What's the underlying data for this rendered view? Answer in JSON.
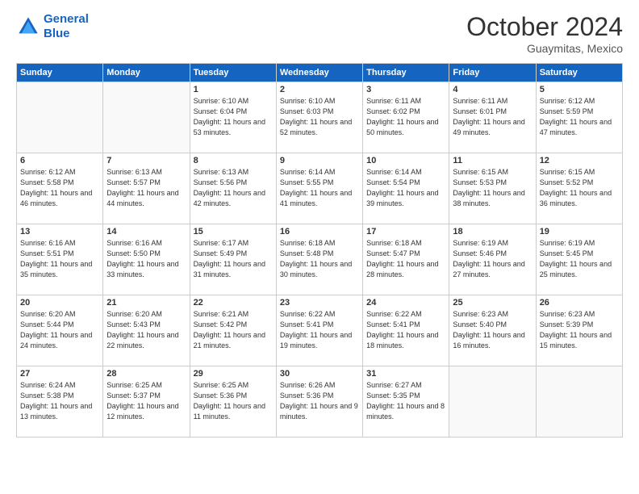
{
  "header": {
    "logo_line1": "General",
    "logo_line2": "Blue",
    "month": "October 2024",
    "location": "Guaymitas, Mexico"
  },
  "weekdays": [
    "Sunday",
    "Monday",
    "Tuesday",
    "Wednesday",
    "Thursday",
    "Friday",
    "Saturday"
  ],
  "weeks": [
    [
      {
        "day": "",
        "info": ""
      },
      {
        "day": "",
        "info": ""
      },
      {
        "day": "1",
        "info": "Sunrise: 6:10 AM\nSunset: 6:04 PM\nDaylight: 11 hours and 53 minutes."
      },
      {
        "day": "2",
        "info": "Sunrise: 6:10 AM\nSunset: 6:03 PM\nDaylight: 11 hours and 52 minutes."
      },
      {
        "day": "3",
        "info": "Sunrise: 6:11 AM\nSunset: 6:02 PM\nDaylight: 11 hours and 50 minutes."
      },
      {
        "day": "4",
        "info": "Sunrise: 6:11 AM\nSunset: 6:01 PM\nDaylight: 11 hours and 49 minutes."
      },
      {
        "day": "5",
        "info": "Sunrise: 6:12 AM\nSunset: 5:59 PM\nDaylight: 11 hours and 47 minutes."
      }
    ],
    [
      {
        "day": "6",
        "info": "Sunrise: 6:12 AM\nSunset: 5:58 PM\nDaylight: 11 hours and 46 minutes."
      },
      {
        "day": "7",
        "info": "Sunrise: 6:13 AM\nSunset: 5:57 PM\nDaylight: 11 hours and 44 minutes."
      },
      {
        "day": "8",
        "info": "Sunrise: 6:13 AM\nSunset: 5:56 PM\nDaylight: 11 hours and 42 minutes."
      },
      {
        "day": "9",
        "info": "Sunrise: 6:14 AM\nSunset: 5:55 PM\nDaylight: 11 hours and 41 minutes."
      },
      {
        "day": "10",
        "info": "Sunrise: 6:14 AM\nSunset: 5:54 PM\nDaylight: 11 hours and 39 minutes."
      },
      {
        "day": "11",
        "info": "Sunrise: 6:15 AM\nSunset: 5:53 PM\nDaylight: 11 hours and 38 minutes."
      },
      {
        "day": "12",
        "info": "Sunrise: 6:15 AM\nSunset: 5:52 PM\nDaylight: 11 hours and 36 minutes."
      }
    ],
    [
      {
        "day": "13",
        "info": "Sunrise: 6:16 AM\nSunset: 5:51 PM\nDaylight: 11 hours and 35 minutes."
      },
      {
        "day": "14",
        "info": "Sunrise: 6:16 AM\nSunset: 5:50 PM\nDaylight: 11 hours and 33 minutes."
      },
      {
        "day": "15",
        "info": "Sunrise: 6:17 AM\nSunset: 5:49 PM\nDaylight: 11 hours and 31 minutes."
      },
      {
        "day": "16",
        "info": "Sunrise: 6:18 AM\nSunset: 5:48 PM\nDaylight: 11 hours and 30 minutes."
      },
      {
        "day": "17",
        "info": "Sunrise: 6:18 AM\nSunset: 5:47 PM\nDaylight: 11 hours and 28 minutes."
      },
      {
        "day": "18",
        "info": "Sunrise: 6:19 AM\nSunset: 5:46 PM\nDaylight: 11 hours and 27 minutes."
      },
      {
        "day": "19",
        "info": "Sunrise: 6:19 AM\nSunset: 5:45 PM\nDaylight: 11 hours and 25 minutes."
      }
    ],
    [
      {
        "day": "20",
        "info": "Sunrise: 6:20 AM\nSunset: 5:44 PM\nDaylight: 11 hours and 24 minutes."
      },
      {
        "day": "21",
        "info": "Sunrise: 6:20 AM\nSunset: 5:43 PM\nDaylight: 11 hours and 22 minutes."
      },
      {
        "day": "22",
        "info": "Sunrise: 6:21 AM\nSunset: 5:42 PM\nDaylight: 11 hours and 21 minutes."
      },
      {
        "day": "23",
        "info": "Sunrise: 6:22 AM\nSunset: 5:41 PM\nDaylight: 11 hours and 19 minutes."
      },
      {
        "day": "24",
        "info": "Sunrise: 6:22 AM\nSunset: 5:41 PM\nDaylight: 11 hours and 18 minutes."
      },
      {
        "day": "25",
        "info": "Sunrise: 6:23 AM\nSunset: 5:40 PM\nDaylight: 11 hours and 16 minutes."
      },
      {
        "day": "26",
        "info": "Sunrise: 6:23 AM\nSunset: 5:39 PM\nDaylight: 11 hours and 15 minutes."
      }
    ],
    [
      {
        "day": "27",
        "info": "Sunrise: 6:24 AM\nSunset: 5:38 PM\nDaylight: 11 hours and 13 minutes."
      },
      {
        "day": "28",
        "info": "Sunrise: 6:25 AM\nSunset: 5:37 PM\nDaylight: 11 hours and 12 minutes."
      },
      {
        "day": "29",
        "info": "Sunrise: 6:25 AM\nSunset: 5:36 PM\nDaylight: 11 hours and 11 minutes."
      },
      {
        "day": "30",
        "info": "Sunrise: 6:26 AM\nSunset: 5:36 PM\nDaylight: 11 hours and 9 minutes."
      },
      {
        "day": "31",
        "info": "Sunrise: 6:27 AM\nSunset: 5:35 PM\nDaylight: 11 hours and 8 minutes."
      },
      {
        "day": "",
        "info": ""
      },
      {
        "day": "",
        "info": ""
      }
    ]
  ]
}
